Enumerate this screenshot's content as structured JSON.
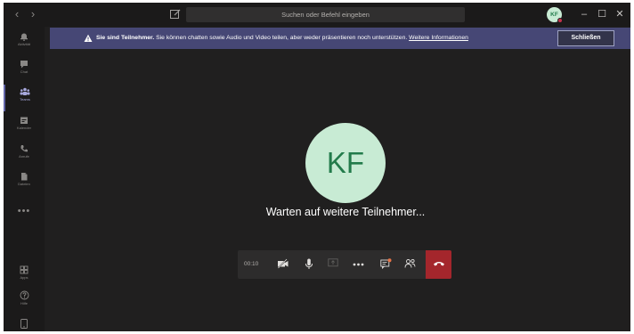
{
  "titlebar": {
    "search_placeholder": "Suchen oder Befehl eingeben",
    "user_initials": "KF",
    "window_controls": [
      "–",
      "☐",
      "✕"
    ]
  },
  "rail": {
    "items": [
      {
        "label": "Aktivität",
        "icon": "bell-icon"
      },
      {
        "label": "Chat",
        "icon": "chat-icon"
      },
      {
        "label": "Teams",
        "icon": "teams-icon"
      },
      {
        "label": "Kalender",
        "icon": "calendar-icon"
      },
      {
        "label": "Anrufe",
        "icon": "phone-icon"
      },
      {
        "label": "Dateien",
        "icon": "files-icon"
      }
    ],
    "more": "•••",
    "bottom_items": [
      {
        "label": "Apps",
        "icon": "apps-icon"
      },
      {
        "label": "Hilfe",
        "icon": "help-icon"
      }
    ]
  },
  "banner": {
    "bold": "Sie sind Teilnehmer.",
    "text": " Sie können chatten sowie Audio und Video teilen, aber weder präsentieren noch unterstützen. ",
    "link": "Weitere Informationen",
    "close_label": "Schließen"
  },
  "stage": {
    "avatar_initials": "KF",
    "waiting_text": "Warten auf weitere Teilnehmer..."
  },
  "controls": {
    "timer": "00:10",
    "hangup_color": "#a4262c"
  },
  "colors": {
    "accent": "#6264a7",
    "banner": "#464775",
    "avatar_bg": "#c8ebd4",
    "avatar_fg": "#237b4b",
    "background": "#201f1f"
  }
}
